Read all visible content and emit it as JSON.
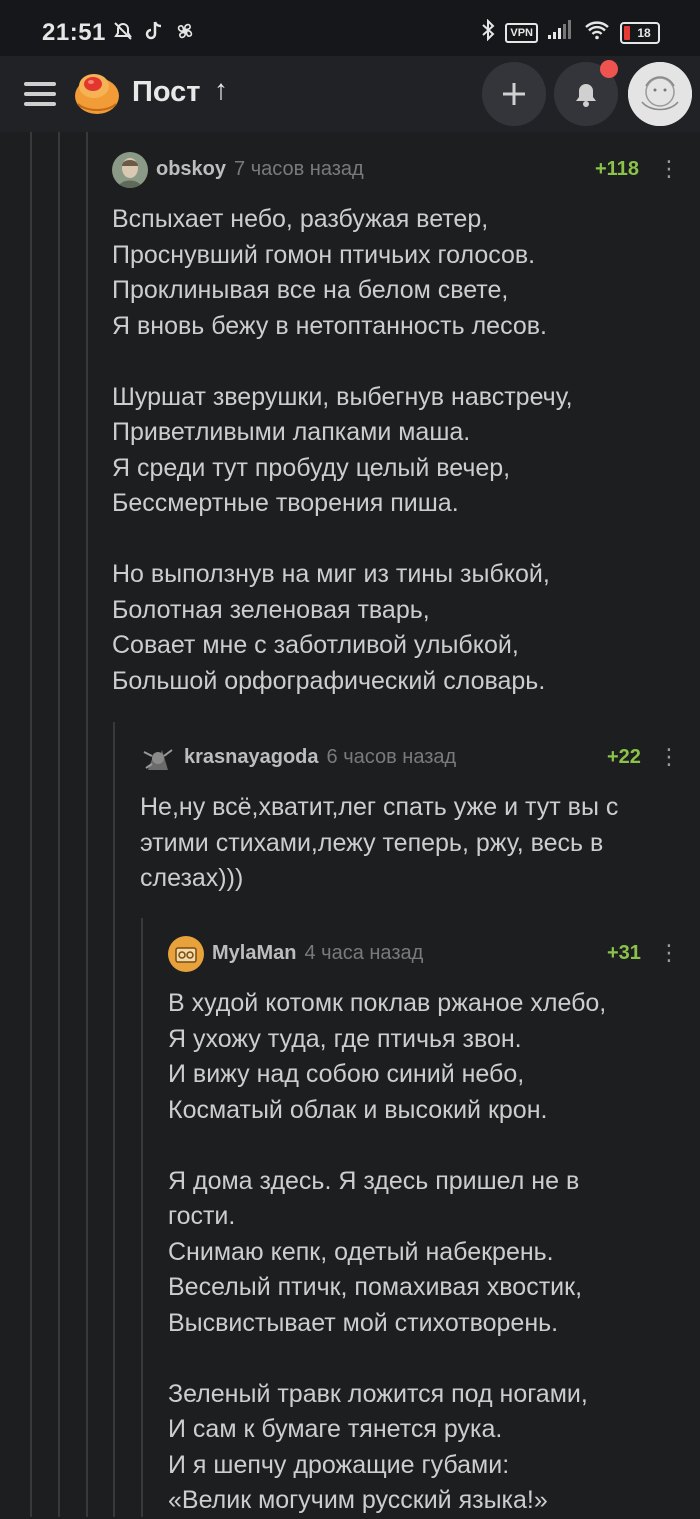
{
  "status_bar": {
    "time": "21:51",
    "vpn": "VPN",
    "battery": "18"
  },
  "header": {
    "title": "Пост"
  },
  "comments": [
    {
      "user": "obskoy",
      "time": "7 часов назад",
      "rating": "+118",
      "text": "Вспыхает небо, разбужая ветер,\nПроснувший гомон птичьих голосов.\nПроклинывая все на белом свете,\nЯ вновь бежу в нетоптанность лесов.\n\nШуршат зверушки, выбегнув навстречу,\nПриветливыми лапками маша.\nЯ среди тут пробуду целый вечер,\nБессмертные творения пиша.\n\nНо выползнув на миг из тины зыбкой,\nБолотная зеленовая тварь,\nСовает мне с заботливой улыбкой,\nБольшой орфографический словарь."
    },
    {
      "user": "krasnayagoda",
      "time": "6 часов назад",
      "rating": "+22",
      "text": "Не,ну всё,хватит,лег спать уже и тут вы с\nэтими стихами,лежу теперь, ржу, весь в\nслезах)))"
    },
    {
      "user": "MylaMan",
      "time": "4 часа назад",
      "rating": "+31",
      "text": "В худой котомк поклав ржаное хлебо,\nЯ ухожу туда, где птичья звон.\nИ вижу над собою синий небо,\nКосматый облак и высокий крон.\n\nЯ дома здесь. Я здесь пришел не в\nгости.\nСнимаю кепк, одетый набекрень.\nВеселый птичк, помахивая хвостик,\nВысвистывает мой стихотворень.\n\nЗеленый травк ложится под ногами,\nИ сам к бумаге тянется рука.\nИ я шепчу дрожащие губами:\n«Велик могучим русский языка!»"
    }
  ],
  "icons": {
    "menu": "hamburger-icon",
    "logo": "pikabu-logo-icon",
    "add": "plus-icon",
    "notifications": "bell-icon",
    "more": "more-vertical-icon"
  },
  "colors": {
    "background": "#1d1e20",
    "rating_positive": "#8bc34a",
    "notification_dot": "#ef5350",
    "logo_orange": "#f29c38"
  }
}
